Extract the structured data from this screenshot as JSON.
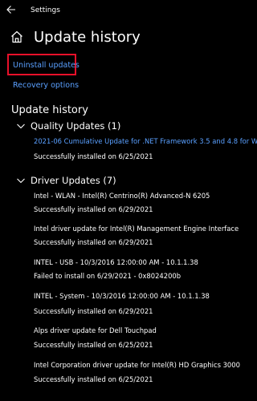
{
  "window": {
    "title": "Settings"
  },
  "header": {
    "title": "Update history"
  },
  "links": {
    "uninstall": "Uninstall updates",
    "recovery": "Recovery options"
  },
  "section": {
    "title": "Update history"
  },
  "quality": {
    "title": "Quality Updates (1)",
    "items": [
      {
        "name": "2021-06 Cumulative Update for .NET Framework 3.5 and 4.8 for W",
        "status": "Successfully installed on 6/25/2021"
      }
    ]
  },
  "driver": {
    "title": "Driver Updates (7)",
    "items": [
      {
        "name": "Intel - WLAN - Intel(R) Centrino(R) Advanced-N 6205",
        "status": "Successfully installed on 6/29/2021"
      },
      {
        "name": "Intel driver update for Intel(R) Management Engine Interface",
        "status": "Successfully installed on 6/29/2021"
      },
      {
        "name": "INTEL - USB - 10/3/2016 12:00:00 AM - 10.1.1.38",
        "status": "Failed to install on 6/29/2021 - 0x8024200b"
      },
      {
        "name": "INTEL - System - 10/3/2016 12:00:00 AM - 10.1.1.38",
        "status": "Successfully installed on 6/29/2021"
      },
      {
        "name": "Alps driver update for Dell Touchpad",
        "status": "Successfully installed on 6/25/2021"
      },
      {
        "name": "Intel Corporation driver update for Intel(R) HD Graphics 3000",
        "status": "Successfully installed on 6/25/2021"
      }
    ]
  }
}
